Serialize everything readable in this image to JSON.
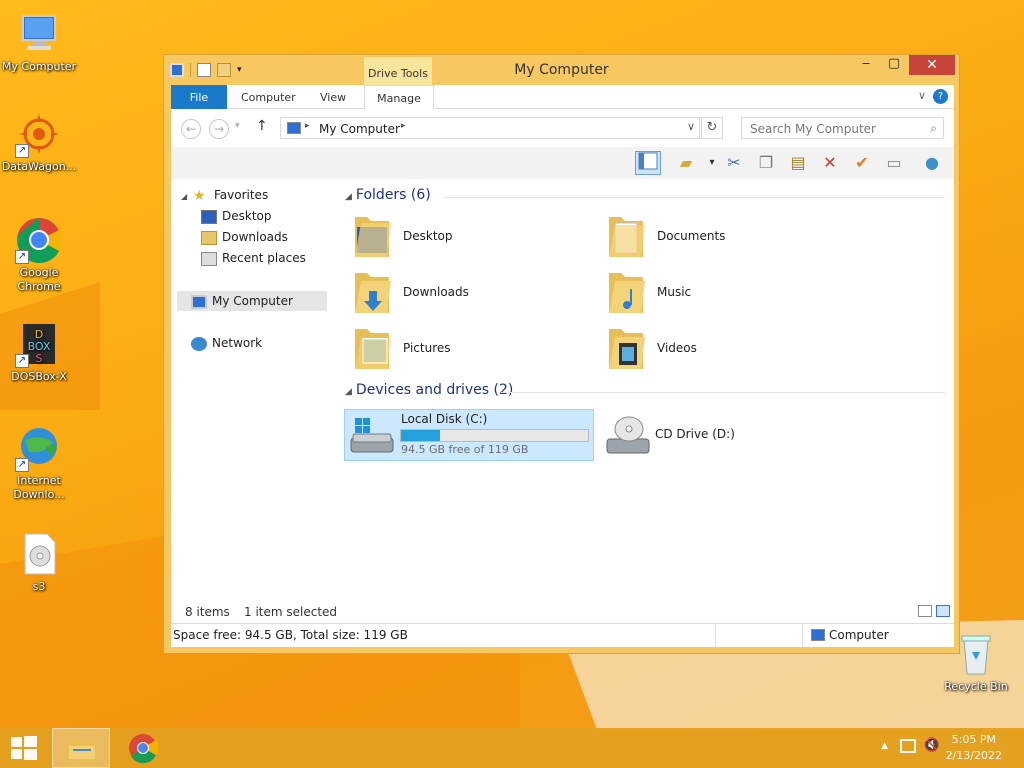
{
  "desktop": {
    "icons": [
      {
        "label": "My Computer"
      },
      {
        "label": "DataWagon..."
      },
      {
        "label": "Google Chrome"
      },
      {
        "label": "DOSBox-X"
      },
      {
        "label": "Internet Downlo..."
      },
      {
        "label": "s3"
      },
      {
        "label": "Recycle Bin"
      }
    ]
  },
  "window": {
    "title": "My Computer",
    "context_tab": "Drive Tools",
    "ribbon_tabs": [
      "File",
      "Computer",
      "View",
      "Manage"
    ],
    "address_path": "My Computer",
    "search_placeholder": "Search My Computer",
    "nav": {
      "favorites": "Favorites",
      "desktop": "Desktop",
      "downloads": "Downloads",
      "recent": "Recent places",
      "computer": "My Computer",
      "network": "Network"
    },
    "folders_header": "Folders (6)",
    "folders": [
      "Desktop",
      "Documents",
      "Downloads",
      "Music",
      "Pictures",
      "Videos"
    ],
    "drives_header": "Devices and drives (2)",
    "drives": [
      {
        "name": "Local Disk (C:)",
        "free": "94.5 GB free of 119 GB",
        "used_fraction": 0.21
      },
      {
        "name": "CD Drive (D:)"
      }
    ],
    "status": {
      "items": "8 items",
      "selected": "1 item selected",
      "space": "Space free: 94.5 GB, Total size: 119 GB",
      "location": "Computer"
    }
  },
  "taskbar": {
    "time": "5:05 PM",
    "date": "2/13/2022"
  },
  "colors": {
    "accent": "#1979ca",
    "selection": "#cce8ff",
    "progress": "#26a0da",
    "close": "#c7443a"
  }
}
